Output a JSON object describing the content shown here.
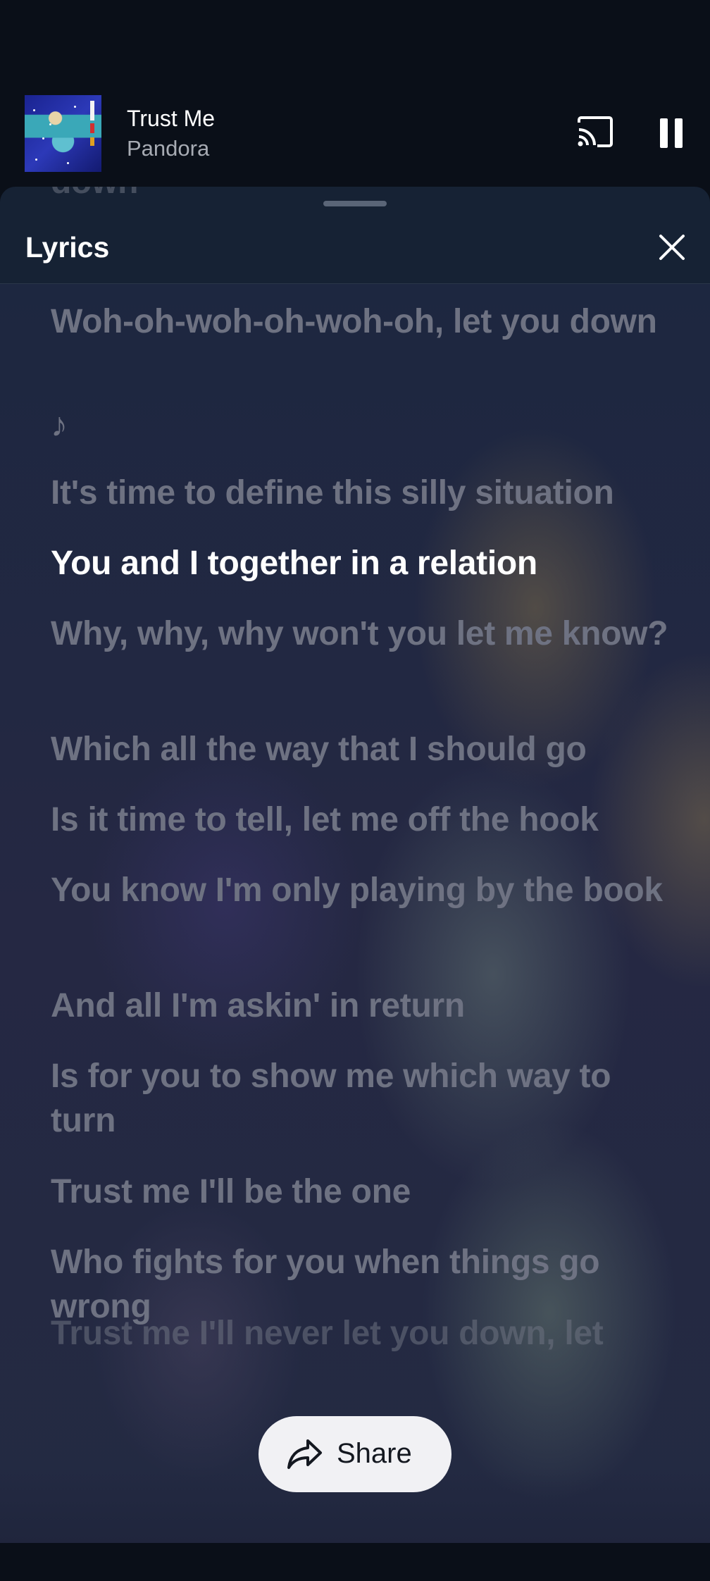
{
  "now_playing": {
    "title": "Trust Me",
    "artist": "Pandora",
    "cast_icon": "cast-icon",
    "pause_icon": "pause-icon"
  },
  "lyrics_sheet": {
    "title": "Lyrics",
    "close_icon": "close-icon",
    "lines": [
      {
        "text": "down",
        "state": "faded"
      },
      {
        "text": "Woh-oh-woh-oh-woh-oh",
        "state": "inactive"
      },
      {
        "text": "Woh-oh-woh-oh-woh-oh, let you down",
        "state": "inactive"
      },
      {
        "text": "♪",
        "state": "inactive"
      },
      {
        "text": "It's time to define this silly situation",
        "state": "inactive"
      },
      {
        "text": "You and I together in a relation",
        "state": "active"
      },
      {
        "text": "Why, why, why won't you let me know?",
        "state": "inactive"
      },
      {
        "text": "Which all the way that I should go",
        "state": "inactive"
      },
      {
        "text": "Is it time to tell, let me off the hook",
        "state": "inactive"
      },
      {
        "text": "You know I'm only playing by the book",
        "state": "inactive"
      },
      {
        "text": "And all I'm askin' in return",
        "state": "inactive"
      },
      {
        "text": "Is for you to show me which way to turn",
        "state": "inactive"
      },
      {
        "text": "Trust me I'll be the one",
        "state": "inactive"
      },
      {
        "text": "Who fights for you when things go wrong",
        "state": "inactive"
      },
      {
        "text": "Trust me I'll never let you down, let",
        "state": "faded"
      }
    ],
    "share": {
      "label": "Share",
      "icon": "share-icon"
    }
  },
  "colors": {
    "background": "#0a0f18",
    "sheet": "#162234",
    "active_lyric": "#ffffff",
    "inactive_lyric": "#6e7282",
    "share_button": "#f1f1f4"
  }
}
